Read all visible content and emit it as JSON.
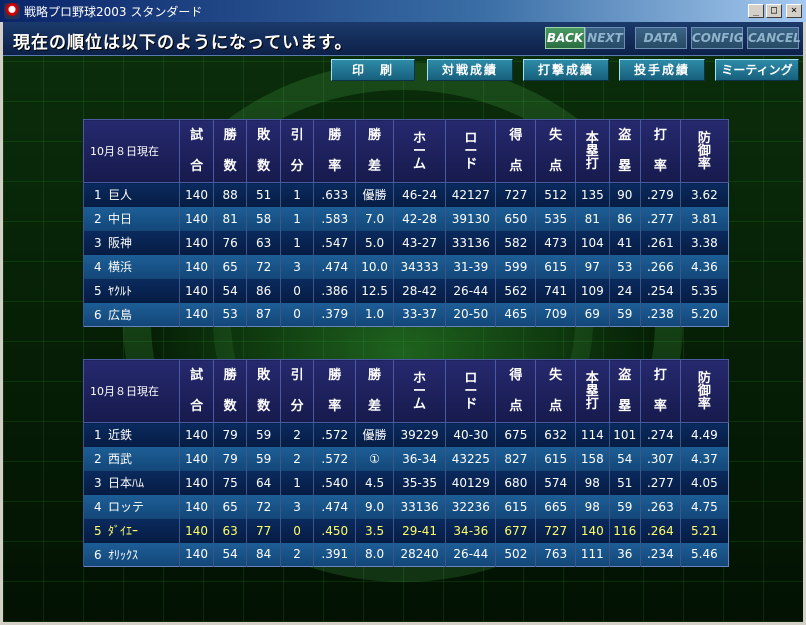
{
  "window": {
    "title": "戦略プロ野球2003 スタンダード",
    "min": "_",
    "max": "□",
    "close": "×"
  },
  "header": {
    "message": "現在の順位は以下のようになっています。"
  },
  "nav": {
    "back": "BACK",
    "next": "NEXT",
    "data": "DATA",
    "config": "CONFIG",
    "cancel": "CANCEL"
  },
  "actions": {
    "print": "印　刷",
    "head_to_head": "対戦成績",
    "batting": "打撃成績",
    "pitching": "投手成績",
    "meeting": "ミーティング"
  },
  "columns": {
    "games": [
      "試",
      "合"
    ],
    "wins": [
      "勝",
      "数"
    ],
    "losses": [
      "敗",
      "数"
    ],
    "draws": [
      "引",
      "分"
    ],
    "pct": [
      "勝",
      "率"
    ],
    "gb": [
      "勝",
      "差"
    ],
    "home": "ホーム",
    "road": "ロード",
    "runs": [
      "得",
      "点"
    ],
    "runs_allowed": [
      "失",
      "点"
    ],
    "hr": [
      "本",
      "塁",
      "打"
    ],
    "sb": [
      "盗",
      "塁"
    ],
    "avg": [
      "打",
      "率"
    ],
    "era": [
      "防",
      "御",
      "率"
    ]
  },
  "league1": {
    "date_label": "10月８日現在",
    "rows": [
      {
        "rank": "1",
        "team": "巨人",
        "g": "140",
        "w": "88",
        "l": "51",
        "d": "1",
        "pct": ".633",
        "gb": "優勝",
        "home": "46-24",
        "road": "42127",
        "rs": "727",
        "ra": "512",
        "hr": "135",
        "sb": "90",
        "avg": ".279",
        "era": "3.62"
      },
      {
        "rank": "2",
        "team": "中日",
        "g": "140",
        "w": "81",
        "l": "58",
        "d": "1",
        "pct": ".583",
        "gb": "7.0",
        "home": "42-28",
        "road": "39130",
        "rs": "650",
        "ra": "535",
        "hr": "81",
        "sb": "86",
        "avg": ".277",
        "era": "3.81"
      },
      {
        "rank": "3",
        "team": "阪神",
        "g": "140",
        "w": "76",
        "l": "63",
        "d": "1",
        "pct": ".547",
        "gb": "5.0",
        "home": "43-27",
        "road": "33136",
        "rs": "582",
        "ra": "473",
        "hr": "104",
        "sb": "41",
        "avg": ".261",
        "era": "3.38"
      },
      {
        "rank": "4",
        "team": "横浜",
        "g": "140",
        "w": "65",
        "l": "72",
        "d": "3",
        "pct": ".474",
        "gb": "10.0",
        "home": "34333",
        "road": "31-39",
        "rs": "599",
        "ra": "615",
        "hr": "97",
        "sb": "53",
        "avg": ".266",
        "era": "4.36"
      },
      {
        "rank": "5",
        "team": "ﾔｸﾙﾄ",
        "g": "140",
        "w": "54",
        "l": "86",
        "d": "0",
        "pct": ".386",
        "gb": "12.5",
        "home": "28-42",
        "road": "26-44",
        "rs": "562",
        "ra": "741",
        "hr": "109",
        "sb": "24",
        "avg": ".254",
        "era": "5.35"
      },
      {
        "rank": "6",
        "team": "広島",
        "g": "140",
        "w": "53",
        "l": "87",
        "d": "0",
        "pct": ".379",
        "gb": "1.0",
        "home": "33-37",
        "road": "20-50",
        "rs": "465",
        "ra": "709",
        "hr": "69",
        "sb": "59",
        "avg": ".238",
        "era": "5.20"
      }
    ]
  },
  "league2": {
    "date_label": "10月８日現在",
    "rows": [
      {
        "rank": "1",
        "team": "近鉄",
        "g": "140",
        "w": "79",
        "l": "59",
        "d": "2",
        "pct": ".572",
        "gb": "優勝",
        "home": "39229",
        "road": "40-30",
        "rs": "675",
        "ra": "632",
        "hr": "114",
        "sb": "101",
        "avg": ".274",
        "era": "4.49"
      },
      {
        "rank": "2",
        "team": "西武",
        "g": "140",
        "w": "79",
        "l": "59",
        "d": "2",
        "pct": ".572",
        "gb": "①",
        "home": "36-34",
        "road": "43225",
        "rs": "827",
        "ra": "615",
        "hr": "158",
        "sb": "54",
        "avg": ".307",
        "era": "4.37"
      },
      {
        "rank": "3",
        "team": "日本ﾊﾑ",
        "g": "140",
        "w": "75",
        "l": "64",
        "d": "1",
        "pct": ".540",
        "gb": "4.5",
        "home": "35-35",
        "road": "40129",
        "rs": "680",
        "ra": "574",
        "hr": "98",
        "sb": "51",
        "avg": ".277",
        "era": "4.05"
      },
      {
        "rank": "4",
        "team": "ロッテ",
        "g": "140",
        "w": "65",
        "l": "72",
        "d": "3",
        "pct": ".474",
        "gb": "9.0",
        "home": "33136",
        "road": "32236",
        "rs": "615",
        "ra": "665",
        "hr": "98",
        "sb": "59",
        "avg": ".263",
        "era": "4.75"
      },
      {
        "rank": "5",
        "team": "ﾀﾞｲｴｰ",
        "g": "140",
        "w": "63",
        "l": "77",
        "d": "0",
        "pct": ".450",
        "gb": "3.5",
        "home": "29-41",
        "road": "34-36",
        "rs": "677",
        "ra": "727",
        "hr": "140",
        "sb": "116",
        "avg": ".264",
        "era": "5.21"
      },
      {
        "rank": "6",
        "team": "ｵﾘｯｸｽ",
        "g": "140",
        "w": "54",
        "l": "84",
        "d": "2",
        "pct": ".391",
        "gb": "8.0",
        "home": "28240",
        "road": "26-44",
        "rs": "502",
        "ra": "763",
        "hr": "111",
        "sb": "36",
        "avg": ".234",
        "era": "5.46"
      }
    ]
  },
  "colors": {
    "highlight": "#ffff66",
    "header_bg": "#1b3a6b",
    "active_nav": "#4a9a63"
  }
}
